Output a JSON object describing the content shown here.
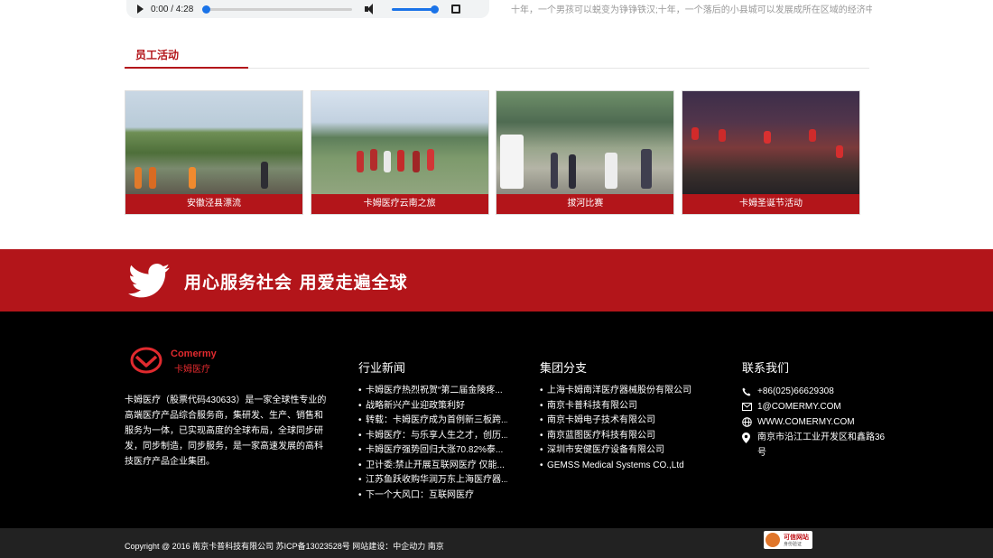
{
  "audio": {
    "time": "0:00 / 4:28",
    "progress": 0,
    "volume": 1.0
  },
  "intro_text": "十年，一个男孩可以蜕变为铮铮铁汉;十年，一个落后的小县城可以发展成所在区域的经济中...",
  "section": {
    "title": "员工活动"
  },
  "activities": [
    {
      "caption": "安徽泾县漂流"
    },
    {
      "caption": "卡姆医疗云南之旅"
    },
    {
      "caption": "拔河比赛"
    },
    {
      "caption": "卡姆圣诞节活动"
    }
  ],
  "banner": {
    "slogan": "用心服务社会  用爱走遍全球",
    "icon": "twitter-bird-icon"
  },
  "footer": {
    "logo": {
      "en": "Comermy",
      "cn": "卡姆医疗"
    },
    "about": "卡姆医疗（股票代码430633）是一家全球性专业的高端医疗产品综合服务商，集研发、生产、销售和服务为一体，已实现高度的全球布局，全球同步研发，同步制造，同步服务，是一家高速发展的高科技医疗产品企业集团。",
    "news": {
      "title": "行业新闻",
      "items": [
        "卡姆医疗热烈祝贺“第二届金陵疼...",
        "战略新兴产业迎政策利好",
        "转载：卡姆医疗成为首例新三板跨...",
        "卡姆医疗：与乐享人生之才，创历...",
        "卡姆医疗强势回归大涨70.82%泰...",
        "卫计委:禁止开展互联网医疗 仅能...",
        "江苏鱼跃收购华润万东上海医疗器...",
        "下一个大风口：互联网医疗"
      ]
    },
    "branches": {
      "title": "集团分支",
      "items": [
        "上海卡姆南洋医疗器械股份有限公司",
        "南京卡普科技有限公司",
        "南京卡姆电子技术有限公司",
        "南京蓝图医疗科技有限公司",
        "深圳市安健医疗设备有限公司",
        "GEMSS Medical Systems CO.,Ltd"
      ]
    },
    "contact": {
      "title": "联系我们",
      "phone": "+86(025)66629308",
      "email": "1@COMERMY.COM",
      "website": "WWW.COMERMY.COM",
      "address": "南京市沿江工业开发区和鑫路36号"
    }
  },
  "bottom": {
    "copyright": "Copyright @ 2016 南京卡普科技有限公司    苏ICP备13023528号    网站建设：中企动力    南京",
    "badge_line1": "可信网站",
    "badge_line2": "身份验证"
  },
  "colors": {
    "brand_red": "#b3151a",
    "footer_bg": "#000000",
    "accent_blue": "#1a73e8"
  }
}
